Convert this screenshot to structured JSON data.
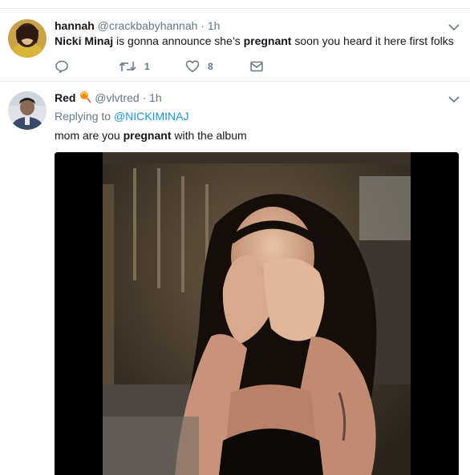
{
  "tweet1": {
    "name": "hannah",
    "handle": "@crackbabyhannah",
    "separator": "·",
    "time": "1h",
    "text_parts": [
      "Nicki Minaj",
      " is gonna announce she’s ",
      "pregnant",
      " soon you heard it here first folks"
    ],
    "actions": {
      "retweet_count": "1",
      "like_count": "8"
    }
  },
  "tweet2": {
    "name": "Red",
    "emoji": "lollipop-emoji",
    "handle": "@vlvtred",
    "separator": "·",
    "time": "1h",
    "replying_prefix": "Replying to ",
    "replying_to": "@NICKIMINAJ",
    "text_parts": [
      "mom are you ",
      "pregnant",
      " with the album"
    ]
  },
  "colors": {
    "secondary_text": "#657786",
    "link": "#1b95e0",
    "divider": "#e6ecf0"
  }
}
